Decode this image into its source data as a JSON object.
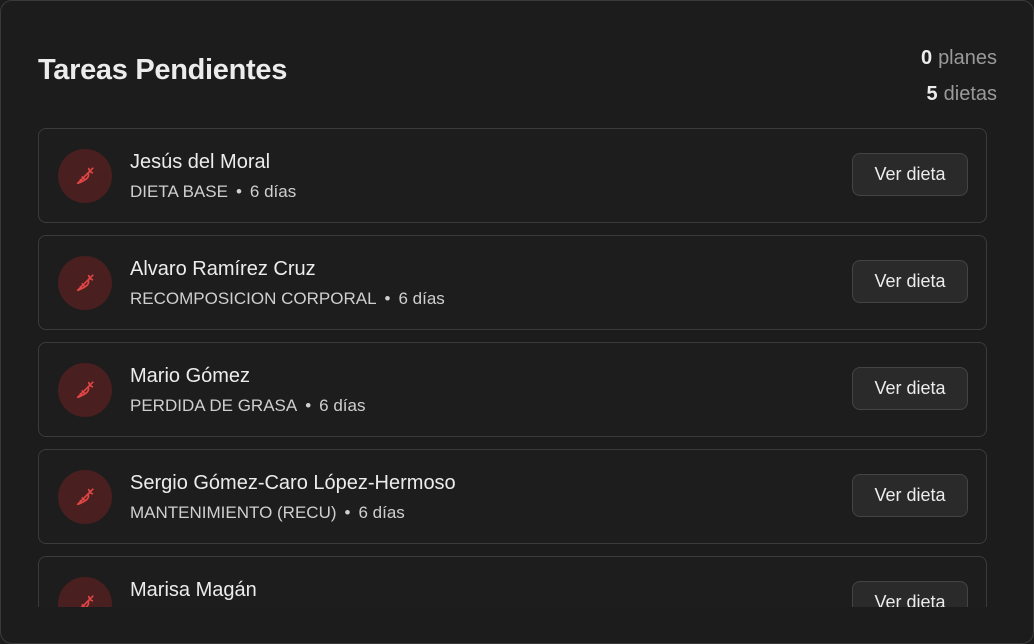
{
  "header": {
    "title": "Tareas Pendientes",
    "plans_count": "0",
    "plans_label": "planes",
    "diets_count": "5",
    "diets_label": "dietas"
  },
  "colors": {
    "accent": "#e04646",
    "avatar_bg": "#4a1f1f"
  },
  "tasks": [
    {
      "name": "Jesús del Moral",
      "plan": "DIETA BASE",
      "days": "6 días",
      "icon": "carrot-icon",
      "action": "Ver dieta"
    },
    {
      "name": "Alvaro Ramírez Cruz",
      "plan": "RECOMPOSICION CORPORAL",
      "days": "6 días",
      "icon": "carrot-icon",
      "action": "Ver dieta"
    },
    {
      "name": "Mario Gómez",
      "plan": "PERDIDA DE GRASA",
      "days": "6 días",
      "icon": "carrot-icon",
      "action": "Ver dieta"
    },
    {
      "name": "Sergio Gómez-Caro López-Hermoso",
      "plan": "MANTENIMIENTO (RECU)",
      "days": "6 días",
      "icon": "carrot-icon",
      "action": "Ver dieta"
    },
    {
      "name": "Marisa Magán",
      "plan": "",
      "days": "",
      "icon": "carrot-icon",
      "action": "Ver dieta"
    }
  ]
}
